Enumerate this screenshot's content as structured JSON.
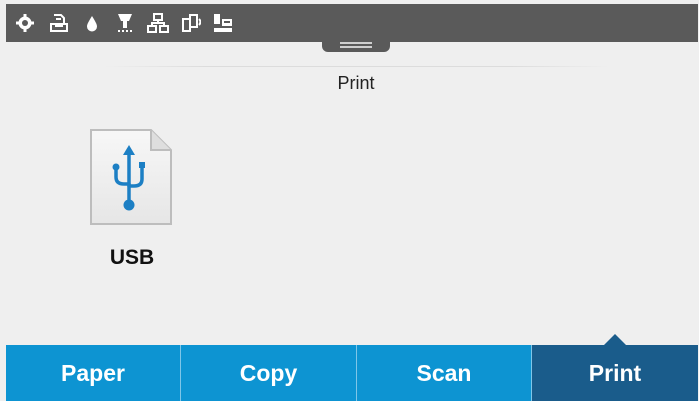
{
  "status_bar": {
    "icons": [
      "settings-icon",
      "paper-tray-icon",
      "ink-drop-icon",
      "cartridge-icon",
      "network-icon",
      "wireless-direct-icon",
      "eprint-icon"
    ]
  },
  "header": {
    "title": "Print"
  },
  "main": {
    "sources": [
      {
        "label": "USB",
        "icon": "usb-icon"
      }
    ]
  },
  "tabs": [
    {
      "label": "Paper",
      "active": false
    },
    {
      "label": "Copy",
      "active": false
    },
    {
      "label": "Scan",
      "active": false
    },
    {
      "label": "Print",
      "active": true
    }
  ],
  "colors": {
    "tab": "#0d94d2",
    "tab_active": "#1a5c8b",
    "status_bar": "#5a5a5a",
    "background": "#efefef",
    "usb_icon": "#1c7fc4"
  }
}
